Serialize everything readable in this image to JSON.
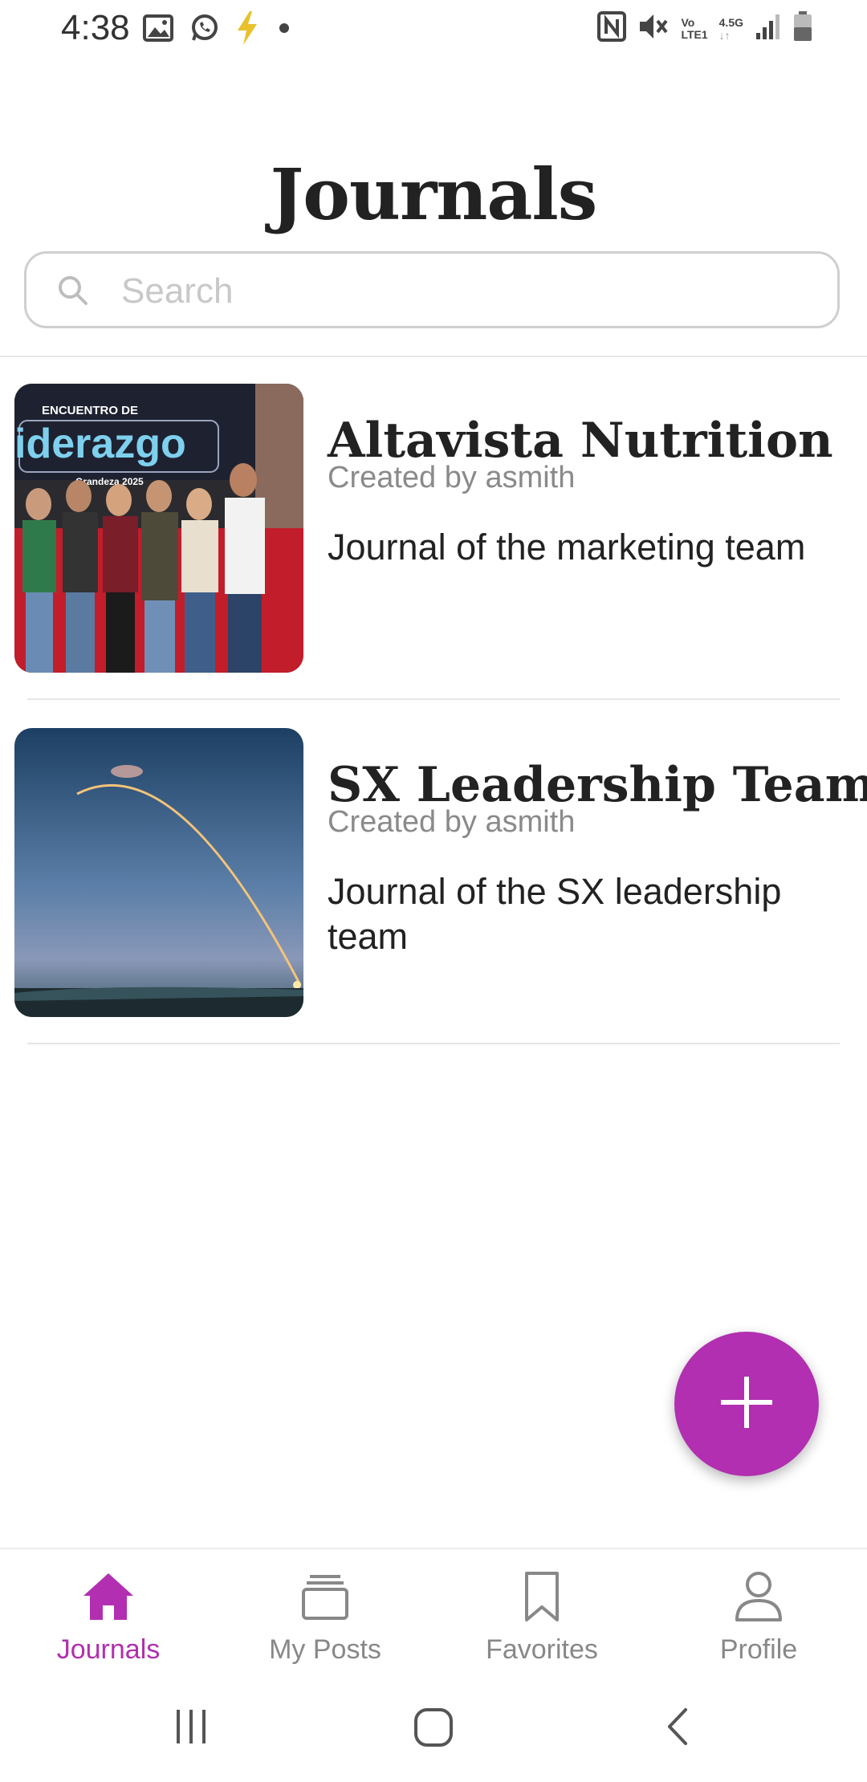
{
  "status_bar": {
    "time": "4:38",
    "left_icons": [
      "image-icon",
      "whatsapp-icon",
      "bolt-icon",
      "dot-icon"
    ],
    "network_label_top": "Vo",
    "network_label_bottom": "LTE1",
    "network_speed": "4.5G",
    "right_icons": [
      "nfc-icon",
      "mute-icon",
      "volte-icon",
      "signal-icon",
      "battery-icon"
    ]
  },
  "page": {
    "title": "Journals"
  },
  "search": {
    "placeholder": "Search",
    "value": ""
  },
  "journals": [
    {
      "title": "Altavista Nutrition",
      "creator": "Created by asmith",
      "description": "Journal of the marketing team",
      "thumbnail": "team-photo",
      "thumbnail_text_1": "ENCUENTRO DE",
      "thumbnail_text_2": "iderazgo",
      "thumbnail_text_3": "Grandeza 2025"
    },
    {
      "title": "SX Leadership Team",
      "creator": "Created by asmith",
      "description": "Journal of the SX leadership team",
      "thumbnail": "rocket-launch-photo"
    }
  ],
  "fab": {
    "icon": "plus-icon"
  },
  "bottom_nav": {
    "items": [
      {
        "label": "Journals",
        "icon": "home-icon",
        "active": true
      },
      {
        "label": "My Posts",
        "icon": "stack-icon",
        "active": false
      },
      {
        "label": "Favorites",
        "icon": "bookmark-icon",
        "active": false
      },
      {
        "label": "Profile",
        "icon": "person-icon",
        "active": false
      }
    ]
  },
  "system_nav": {
    "icons": [
      "recents-icon",
      "home-button-icon",
      "back-icon"
    ]
  },
  "colors": {
    "accent": "#b12fb0",
    "text_primary": "#222222",
    "text_secondary": "#8a8a8a",
    "nav_inactive": "#888888"
  }
}
